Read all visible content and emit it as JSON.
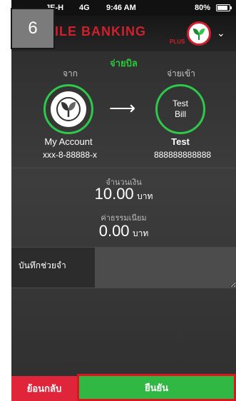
{
  "status_bar": {
    "carrier": "JE-H",
    "network": "4G",
    "time": "9:46 AM",
    "battery": "80%"
  },
  "step_badge": "6",
  "header": {
    "title": "OBILE BANKING",
    "subtitle": "PLUS",
    "logo_icon": "kbank-leaf-icon",
    "menu_icon": "chevron-down-icon"
  },
  "transfer": {
    "title": "จ่ายบิล",
    "from_label": "จาก",
    "to_label": "จ่ายเข้า",
    "from_name": "My Account",
    "from_number": "xxx-8-88888-x",
    "to_circle_line1": "Test",
    "to_circle_line2": "Bill",
    "to_name": "Test",
    "to_number": "888888888888"
  },
  "amount": {
    "label": "จำนวนเงิน",
    "value": "10.00",
    "unit": "บาท"
  },
  "fee": {
    "label": "ค่าธรรมเนียม",
    "value": "0.00",
    "unit": "บาท"
  },
  "memo": {
    "label": "บันทึกช่วยจำ",
    "value": ""
  },
  "buttons": {
    "back": "ย้อนกลับ",
    "confirm": "ยืนยัน"
  },
  "colors": {
    "brand_red": "#d21f2e",
    "accent_green": "#2ec84a",
    "confirm_green": "#31b844",
    "back_red": "#e0253a"
  }
}
